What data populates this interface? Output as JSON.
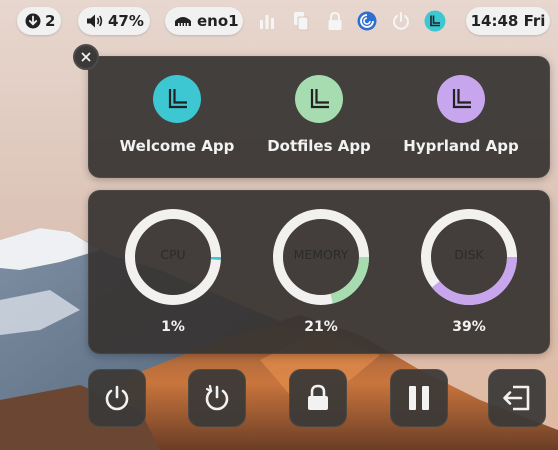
{
  "topbar": {
    "updates_count": "2",
    "volume_label": "47%",
    "network_label": "eno1",
    "clock_label": "14:48 Fri",
    "icons": [
      "download-arrow-icon",
      "speaker-icon",
      "ethernet-icon",
      "bar-chart-icon",
      "clipboard-icon",
      "lock-icon",
      "browser-icon",
      "power-icon",
      "app-logo-icon"
    ]
  },
  "apps": [
    {
      "label": "Welcome App",
      "color": "#3cc7d2"
    },
    {
      "label": "Dotfiles App",
      "color": "#a6dcb0"
    },
    {
      "label": "Hyprland App",
      "color": "#c7a6ee"
    }
  ],
  "stats": [
    {
      "name": "CPU",
      "value_label": "1%",
      "percent": 1,
      "color": "#3cc7d2"
    },
    {
      "name": "MEMORY",
      "value_label": "21%",
      "percent": 21,
      "color": "#a6dcb0"
    },
    {
      "name": "DISK",
      "value_label": "39%",
      "percent": 39,
      "color": "#c7a6ee"
    }
  ],
  "power_buttons": [
    "power-icon",
    "restart-icon",
    "lock-icon",
    "pause-icon",
    "logout-icon"
  ],
  "colors": {
    "panel": "#373432",
    "pill": "#f1f1f1",
    "ring_bg": "#f3f1ef"
  }
}
